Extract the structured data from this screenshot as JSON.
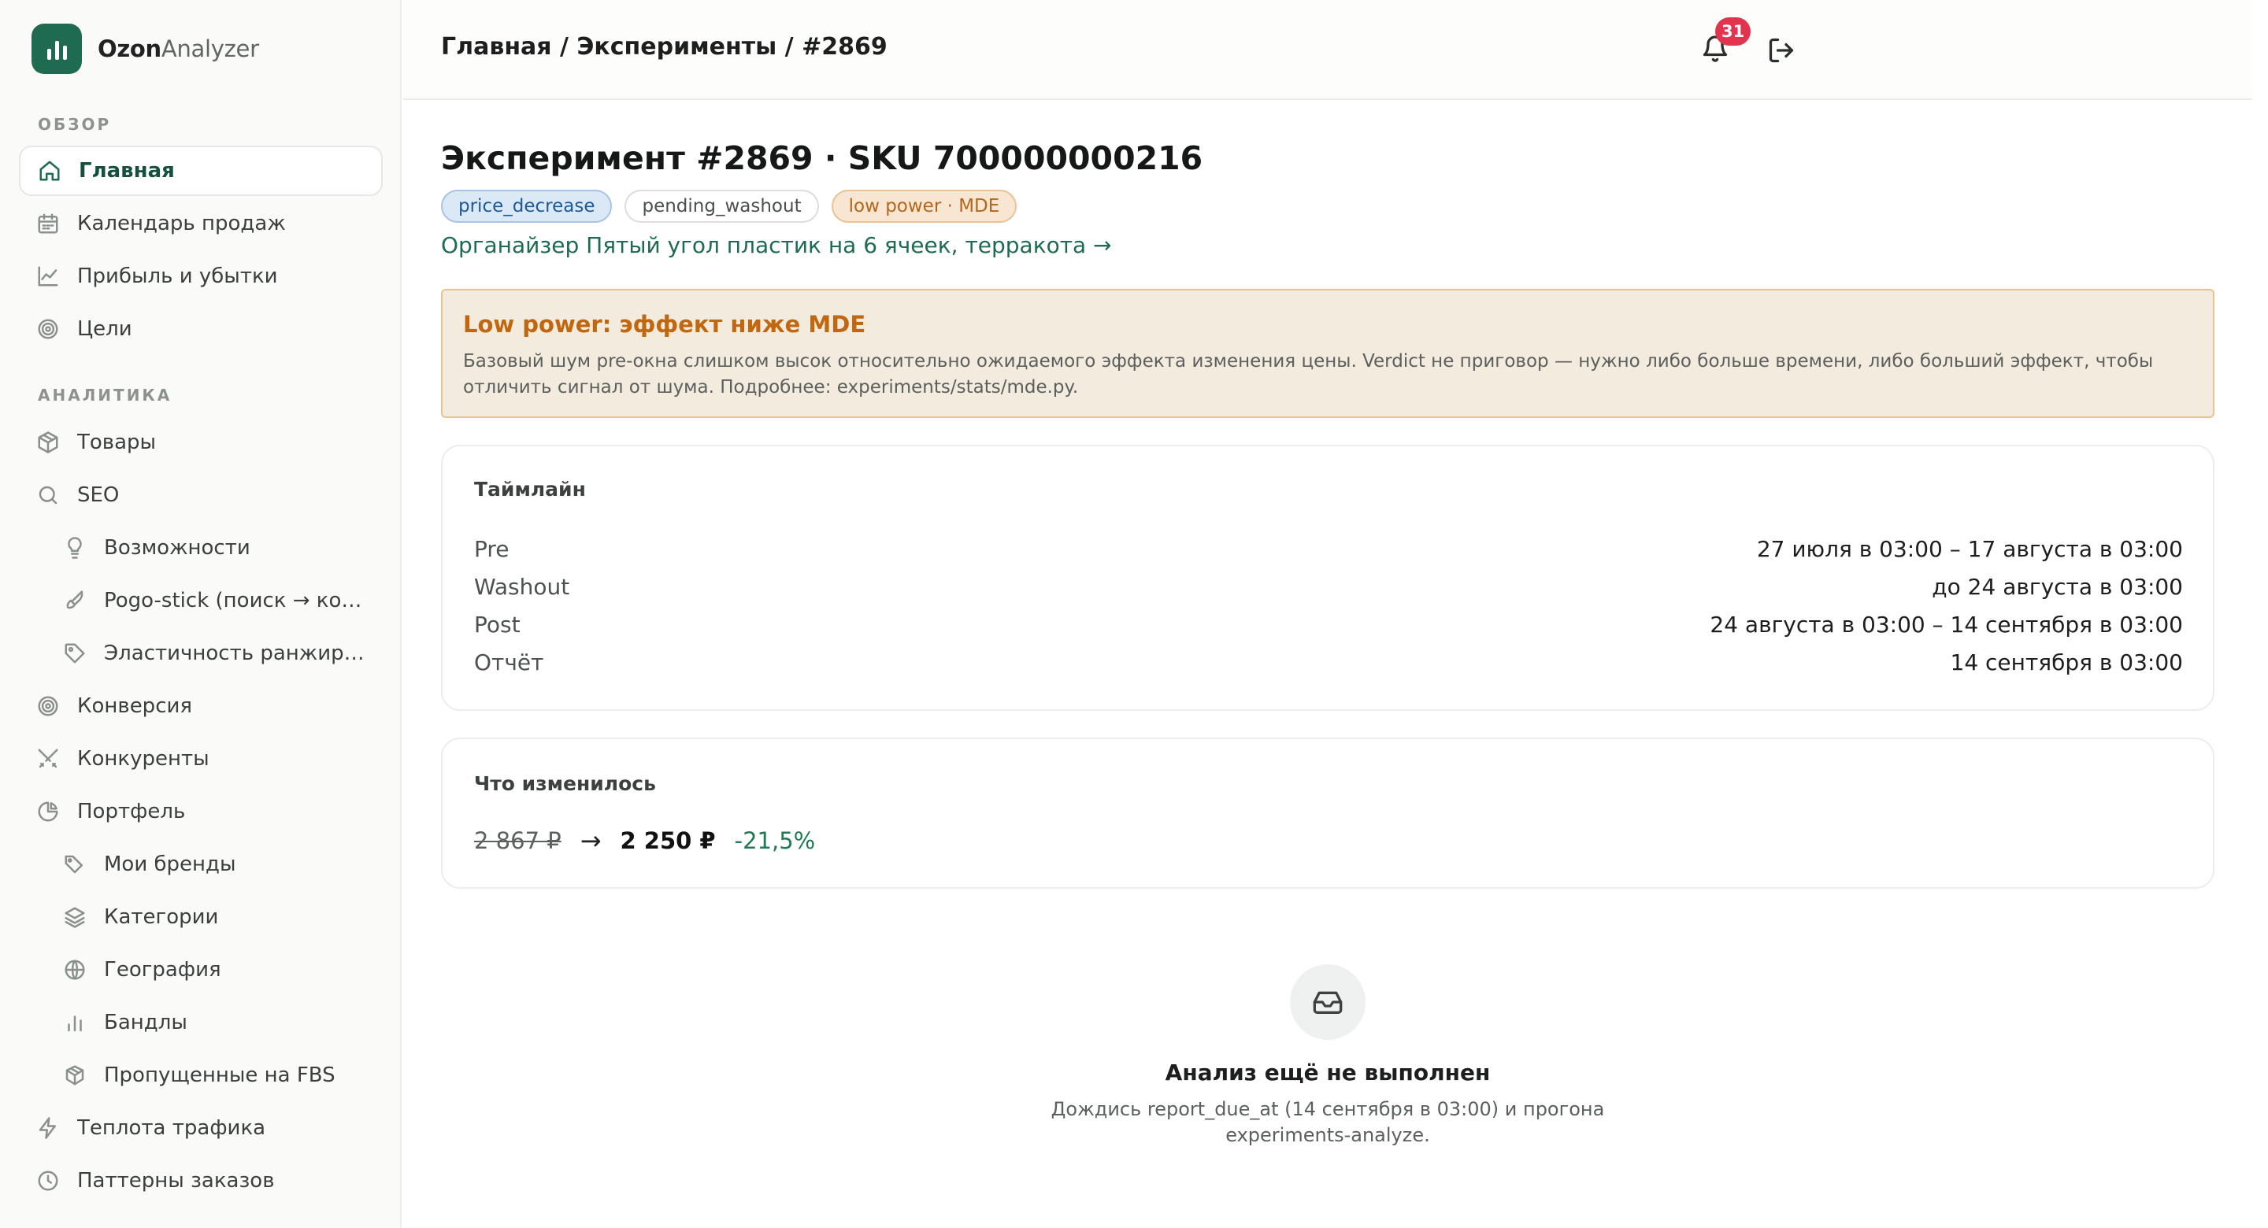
{
  "app": {
    "name_bold": "Ozon",
    "name_light": "Analyzer"
  },
  "sidebar": {
    "sections": [
      {
        "title": "ОБЗОР"
      },
      {
        "title": "АНАЛИТИКА"
      }
    ],
    "items": [
      {
        "label": "Главная",
        "icon": "home-icon",
        "active": true
      },
      {
        "label": "Календарь продаж",
        "icon": "calendar-icon"
      },
      {
        "label": "Прибыль и убытки",
        "icon": "line-chart-icon"
      },
      {
        "label": "Цели",
        "icon": "target-icon"
      },
      {
        "label": "Товары",
        "icon": "box-icon"
      },
      {
        "label": "SEO",
        "icon": "search-icon"
      },
      {
        "label": "Возможности",
        "icon": "lightbulb-icon"
      },
      {
        "label": "Pogo-stick (поиск → кор...",
        "icon": "rocket-icon"
      },
      {
        "label": "Эластичность ранжиров...",
        "icon": "tag-icon"
      },
      {
        "label": "Конверсия",
        "icon": "target-icon"
      },
      {
        "label": "Конкуренты",
        "icon": "swords-icon"
      },
      {
        "label": "Портфель",
        "icon": "pie-chart-icon"
      },
      {
        "label": "Мои бренды",
        "icon": "tags-icon"
      },
      {
        "label": "Категории",
        "icon": "layers-icon"
      },
      {
        "label": "География",
        "icon": "globe-icon"
      },
      {
        "label": "Бандлы",
        "icon": "bar-chart-icon"
      },
      {
        "label": "Пропущенные на FBS",
        "icon": "boxes-icon"
      },
      {
        "label": "Теплота трафика",
        "icon": "zap-icon"
      },
      {
        "label": "Паттерны заказов",
        "icon": "clock-icon"
      }
    ]
  },
  "header": {
    "breadcrumb": "Главная / Эксперименты / #2869",
    "notifications_count": "31"
  },
  "experiment": {
    "title": "Эксперимент #2869 · SKU 700000000216",
    "tags": [
      "price_decrease",
      "pending_washout",
      "low power · MDE"
    ],
    "product_link": "Органайзер Пятый угол пластик на 6 ячеек, терракота →"
  },
  "alert": {
    "title": "Low power: эффект ниже MDE",
    "text": "Базовый шум pre-окна слишком высок относительно ожидаемого эффекта изменения цены. Verdict не приговор — нужно либо больше времени, либо больший эффект, чтобы отличить сигнал от шума. Подробнее: experiments/stats/mde.py."
  },
  "timeline": {
    "title": "Таймлайн",
    "rows": [
      {
        "key": "Pre",
        "value": "27 июля в 03:00 – 17 августа в 03:00"
      },
      {
        "key": "Washout",
        "value": "до 24 августа в 03:00"
      },
      {
        "key": "Post",
        "value": "24 августа в 03:00 – 14 сентября в 03:00"
      },
      {
        "key": "Отчёт",
        "value": "14 сентября в 03:00"
      }
    ]
  },
  "changes": {
    "title": "Что изменилось",
    "old_price": "2 867 ₽",
    "arrow": "→",
    "new_price": "2 250 ₽",
    "delta": "-21,5%"
  },
  "empty_state": {
    "title": "Анализ ещё не выполнен",
    "text": "Дождись report_due_at (14 сентября в 03:00) и прогона experiments-analyze."
  },
  "colors": {
    "accent": "#1f6b52",
    "warning": "#c0670f",
    "badge": "#e2334f",
    "positive": "#1f7a55"
  }
}
